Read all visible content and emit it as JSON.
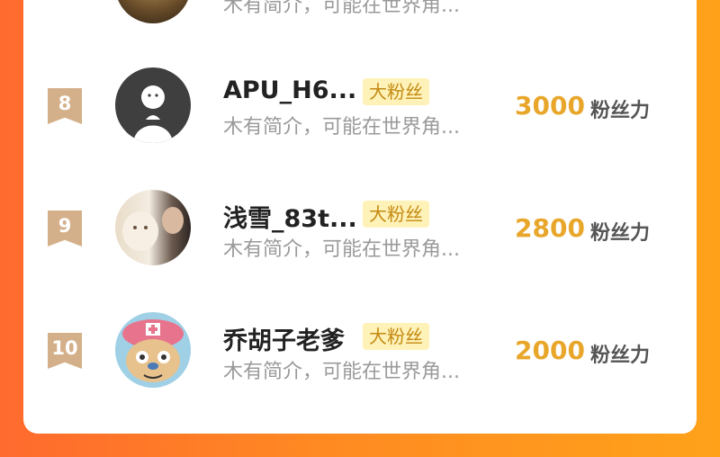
{
  "rows": [
    {
      "rank": "8",
      "name": "APU_H6...",
      "badge": "大粉丝",
      "bio": "木有简介，可能在世界角...",
      "score": "3000",
      "unit": "粉丝力",
      "avatar": "default-avatar"
    },
    {
      "rank": "9",
      "name": "浅雪_83t...",
      "badge": "大粉丝",
      "bio": "木有简介，可能在世界角...",
      "score": "2800",
      "unit": "粉丝力",
      "avatar": "photo-avatar"
    },
    {
      "rank": "10",
      "name": "乔胡子老爹",
      "badge": "大粉丝",
      "bio": "木有简介，可能在世界角...",
      "score": "2000",
      "unit": "粉丝力",
      "avatar": "cartoon-avatar"
    }
  ],
  "top_partial_row": {
    "bio": "木有简介，可能在世界角..."
  },
  "colors": {
    "background_left": "#ff6a2e",
    "background_right": "#ffa21a",
    "badge_bg": "#fff2b8",
    "badge_text": "#c48a12",
    "score": "#e8a62a",
    "rank_ribbon": "#d4b08a"
  }
}
